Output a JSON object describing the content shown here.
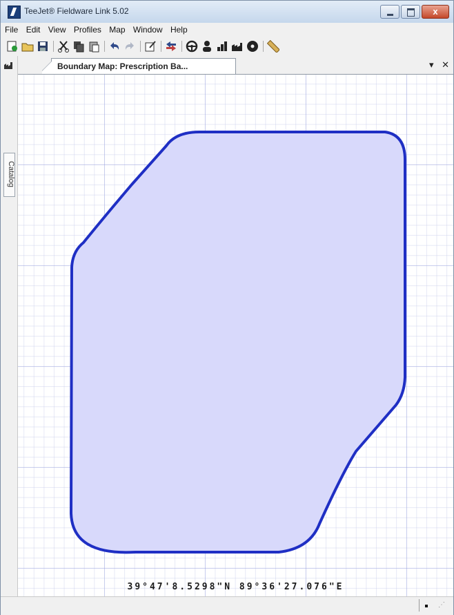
{
  "window": {
    "title": "TeeJet® Fieldware Link 5.02",
    "controls": {
      "minimize": "–",
      "maximize": "□",
      "close": "x"
    }
  },
  "menu": [
    "File",
    "Edit",
    "View",
    "Profiles",
    "Map",
    "Window",
    "Help"
  ],
  "toolbar": {
    "icons": [
      "new-icon",
      "open-folder-icon",
      "save-icon",
      "cut-icon",
      "copy-icon",
      "paste-icon",
      "undo-icon",
      "redo-icon",
      "edit-icon",
      "import-export-icon",
      "steering-wheel-icon",
      "person-icon",
      "bar-chart-icon",
      "factory-icon",
      "disc-icon",
      "ruler-icon"
    ]
  },
  "side_panel": {
    "catalog_label": "Catalog"
  },
  "document_tab": {
    "label": "Boundary Map: Prescription Ba...",
    "dropdown_glyph": "▾",
    "close_glyph": "✕"
  },
  "map": {
    "coordinates": "39°47'8.5298\"N 89°36'27.076\"E",
    "boundary_fill": "#d8d9fb",
    "boundary_stroke": "#1f2fc4"
  },
  "statusbar": {
    "grip": "⋰"
  }
}
